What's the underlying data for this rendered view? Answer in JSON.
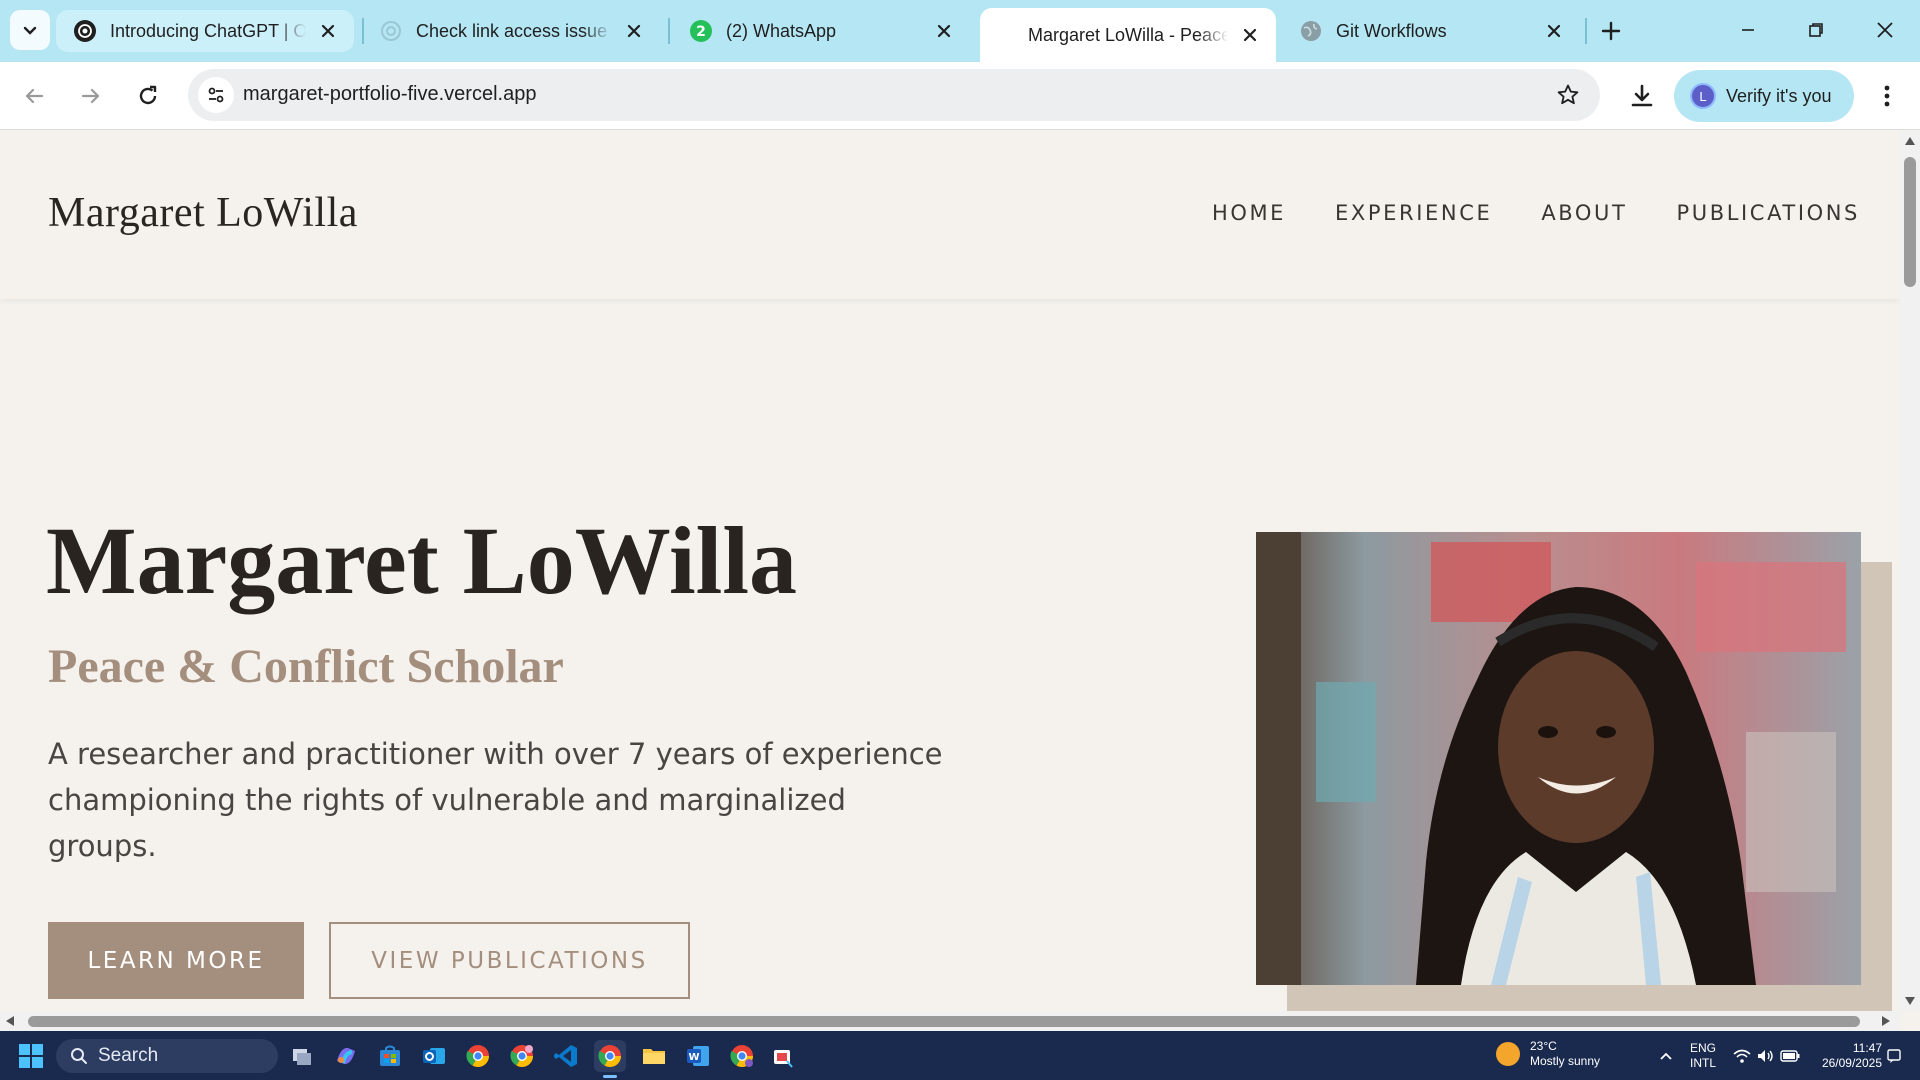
{
  "browser": {
    "tabs": [
      {
        "title": "Introducing ChatGPT | Op",
        "favicon": "openai-icon",
        "active": false
      },
      {
        "title": "Check link access issue",
        "favicon": "openai-icon",
        "active": false
      },
      {
        "title": "(2) WhatsApp",
        "favicon": "whatsapp-icon",
        "badge": "2",
        "active": false
      },
      {
        "title": "Margaret LoWilla - Peace",
        "favicon": "none",
        "active": true
      },
      {
        "title": "Git Workflows",
        "favicon": "globe-icon",
        "active": false
      }
    ],
    "url": "margaret-portfolio-five.vercel.app",
    "verify_label": "Verify it's you",
    "profile_initial": "L"
  },
  "site": {
    "logo": "Margaret LoWilla",
    "nav": [
      "HOME",
      "EXPERIENCE",
      "ABOUT",
      "PUBLICATIONS"
    ],
    "hero": {
      "name": "Margaret LoWilla",
      "role": "Peace & Conflict Scholar",
      "description": "A researcher and practitioner with over 7 years of experience championing the rights of vulnerable and marginalized groups.",
      "learn_more": "LEARN MORE",
      "view_publications": "VIEW PUBLICATIONS"
    }
  },
  "taskbar": {
    "search_label": "Search",
    "weather_temp": "23°C",
    "weather_desc": "Mostly sunny",
    "lang_line1": "ENG",
    "lang_line2": "INTL",
    "time": "11:47",
    "date": "26/09/2025"
  },
  "colors": {
    "accent": "#a48e7d",
    "page_bg": "#f5f2ee",
    "tabstrip": "#b4e6f4",
    "taskbar": "#1a2a4f"
  }
}
